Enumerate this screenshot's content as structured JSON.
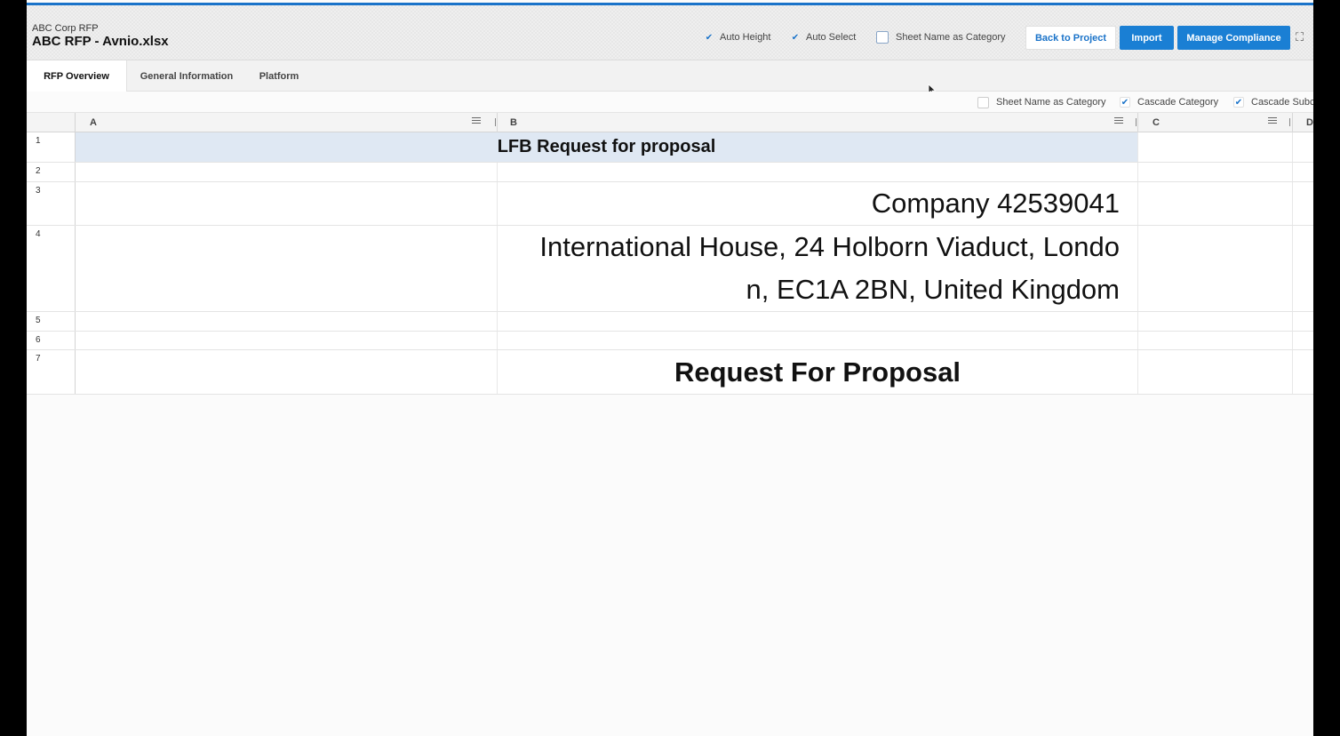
{
  "header": {
    "project_name": "ABC Corp RFP",
    "file_name": "ABC RFP - Avnio.xlsx",
    "options": {
      "auto_height": "Auto Height",
      "auto_select": "Auto Select",
      "sheet_name_as_category": "Sheet Name as Category"
    },
    "buttons": {
      "back": "Back to Project",
      "import": "Import",
      "manage": "Manage Compliance"
    }
  },
  "tabs": [
    "RFP Overview",
    "General Information",
    "Platform"
  ],
  "options_bar": {
    "sheet_name_as_category": "Sheet Name as Category",
    "cascade_category": "Cascade Category",
    "cascade_sub": "Cascade Subc"
  },
  "grid": {
    "columns": [
      "A",
      "B",
      "C",
      "D"
    ],
    "rows": [
      "1",
      "2",
      "3",
      "4",
      "5",
      "6",
      "7"
    ],
    "cells": {
      "r1": "LFB Request for proposal",
      "r3_b": "Company 42539041",
      "r4_b_line1": "International House, 24 Holborn Viaduct, Londo",
      "r4_b_line2": "n, EC1A 2BN, United Kingdom",
      "r7_b": "Request For Proposal"
    }
  },
  "colors": {
    "accent": "#1a73c9",
    "primary_button": "#1a7fd4",
    "title_row_fill": "#dfe8f3"
  }
}
